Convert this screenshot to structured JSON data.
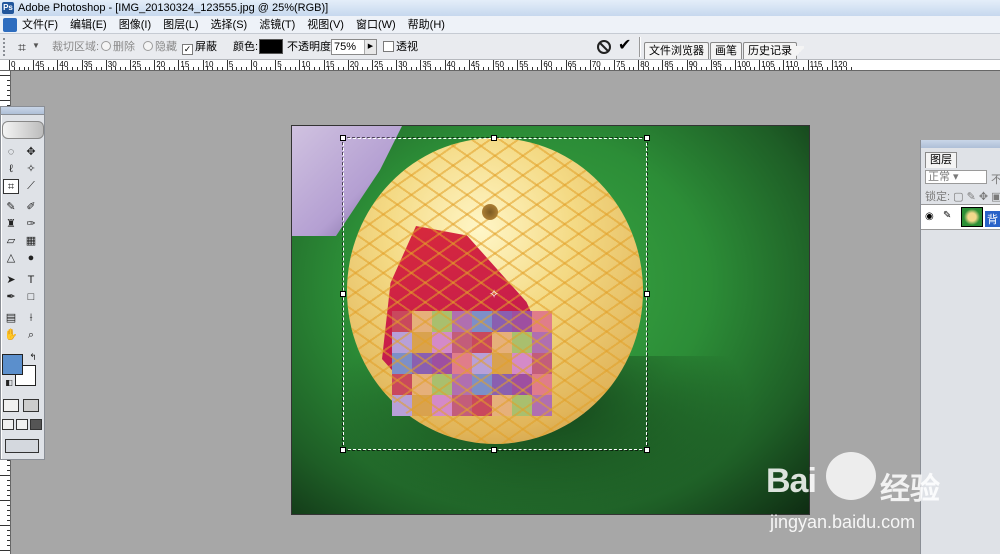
{
  "window": {
    "title": "Adobe Photoshop - [IMG_20130324_123555.jpg @ 25%(RGB)]"
  },
  "menu": [
    "文件(F)",
    "编辑(E)",
    "图像(I)",
    "图层(L)",
    "选择(S)",
    "滤镜(T)",
    "视图(V)",
    "窗口(W)",
    "帮助(H)"
  ],
  "options": {
    "crop_area_label": "裁切区域:",
    "delete_label": "删除",
    "hide_label": "隐藏",
    "shield_label": "屏蔽",
    "shield_checked": true,
    "color_label": "颜色:",
    "shield_color": "#000000",
    "opacity_label": "不透明度:",
    "opacity_value": "75%",
    "perspective_label": "透视",
    "perspective_checked": false
  },
  "palette_well": [
    "文件浏览器",
    "画笔",
    "历史记录"
  ],
  "ruler_labels": [
    "0",
    "45",
    "40",
    "35",
    "30",
    "25",
    "20",
    "15",
    "10",
    "5",
    "0",
    "5",
    "10",
    "15",
    "20",
    "25",
    "30",
    "35",
    "40",
    "45",
    "50",
    "55",
    "60",
    "65",
    "70",
    "75",
    "80",
    "85",
    "90",
    "95",
    "100",
    "105",
    "110",
    "115",
    "120"
  ],
  "colors": {
    "foreground": "#5b8fcc",
    "background": "#ffffff",
    "accent": "#2a63c8"
  },
  "layers_panel": {
    "tab": "图层",
    "blend_mode": "正常",
    "opacity_label": "不",
    "lock_label": "锁定:",
    "layer_name": "背"
  },
  "watermark": {
    "brand": "Bai",
    "suffix": "经验",
    "url": "jingyan.baidu.com"
  }
}
